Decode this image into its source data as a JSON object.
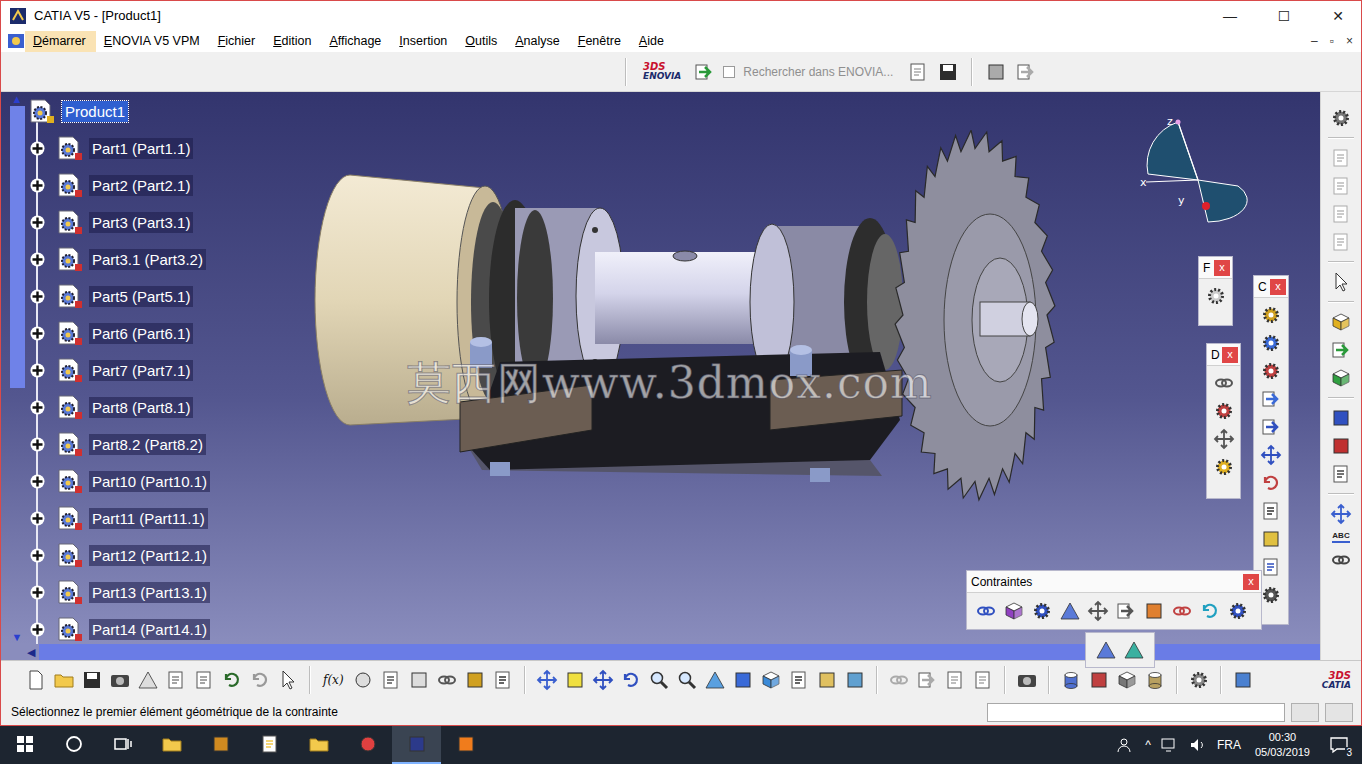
{
  "window": {
    "title": "CATIA V5 - [Product1]",
    "controls": [
      "—",
      "☐",
      "✕"
    ]
  },
  "menu": {
    "items": [
      {
        "label": "Démarrer",
        "selected": true
      },
      {
        "label": "ENOVIA V5 VPM",
        "selected": false
      },
      {
        "label": "Fichier",
        "selected": false
      },
      {
        "label": "Edition",
        "selected": false
      },
      {
        "label": "Affichage",
        "selected": false
      },
      {
        "label": "Insertion",
        "selected": false
      },
      {
        "label": "Outils",
        "selected": false
      },
      {
        "label": "Analyse",
        "selected": false
      },
      {
        "label": "Fenêtre",
        "selected": false
      },
      {
        "label": "Aide",
        "selected": false
      }
    ],
    "doc_controls": [
      "–",
      "▫",
      "×"
    ]
  },
  "top_toolbar": {
    "logo_mark": "3DS",
    "logo": "ENOVIA",
    "search": {
      "label": "Rechercher dans ENOVIA...",
      "checked": false,
      "disabled": true
    }
  },
  "tree": {
    "items": [
      {
        "label": "Product1",
        "kind": "product",
        "selected": true
      },
      {
        "label": "Part1 (Part1.1)",
        "kind": "part",
        "selected": false
      },
      {
        "label": "Part2 (Part2.1)",
        "kind": "part",
        "selected": false
      },
      {
        "label": "Part3 (Part3.1)",
        "kind": "part",
        "selected": false
      },
      {
        "label": "Part3.1 (Part3.2)",
        "kind": "part",
        "selected": false
      },
      {
        "label": "Part5 (Part5.1)",
        "kind": "part",
        "selected": false
      },
      {
        "label": "Part6 (Part6.1)",
        "kind": "part",
        "selected": false
      },
      {
        "label": "Part7 (Part7.1)",
        "kind": "part",
        "selected": false
      },
      {
        "label": "Part8 (Part8.1)",
        "kind": "part",
        "selected": false
      },
      {
        "label": "Part8.2 (Part8.2)",
        "kind": "part",
        "selected": false
      },
      {
        "label": "Part10 (Part10.1)",
        "kind": "part",
        "selected": false
      },
      {
        "label": "Part11 (Part11.1)",
        "kind": "part",
        "selected": false
      },
      {
        "label": "Part12 (Part12.1)",
        "kind": "part",
        "selected": false
      },
      {
        "label": "Part13 (Part13.1)",
        "kind": "part",
        "selected": false
      },
      {
        "label": "Part14 (Part14.1)",
        "kind": "part",
        "selected": false
      }
    ]
  },
  "viewport": {
    "watermark": "莫西网www.3dmox.com",
    "compass": {
      "z": "z",
      "x": "x",
      "y": "y"
    }
  },
  "floating_toolbars": [
    {
      "title": "F",
      "close": "x"
    },
    {
      "title": "D",
      "close": "x"
    },
    {
      "title": "C",
      "close": "x"
    },
    {
      "title": "Contraintes",
      "close": "x"
    }
  ],
  "right_toolbar": {
    "label": "ABC"
  },
  "bottom_toolbar": {
    "formula": "f(x)",
    "logo_mark": "3DS",
    "logo": "CATIA"
  },
  "scrollbars": {
    "up": "▲",
    "down": "▼",
    "left": "◀"
  },
  "status_bar": {
    "message": "Sélectionnez le premier élément géométrique de la contrainte"
  },
  "taskbar": {
    "apps": [
      {
        "selected": false
      },
      {
        "selected": false
      },
      {
        "selected": false
      },
      {
        "selected": false
      },
      {
        "selected": false
      },
      {
        "selected": true
      },
      {
        "selected": false
      }
    ],
    "chevron": "^",
    "language": "FRA",
    "time": "00:30",
    "date": "05/03/2019",
    "notifications": "3"
  }
}
